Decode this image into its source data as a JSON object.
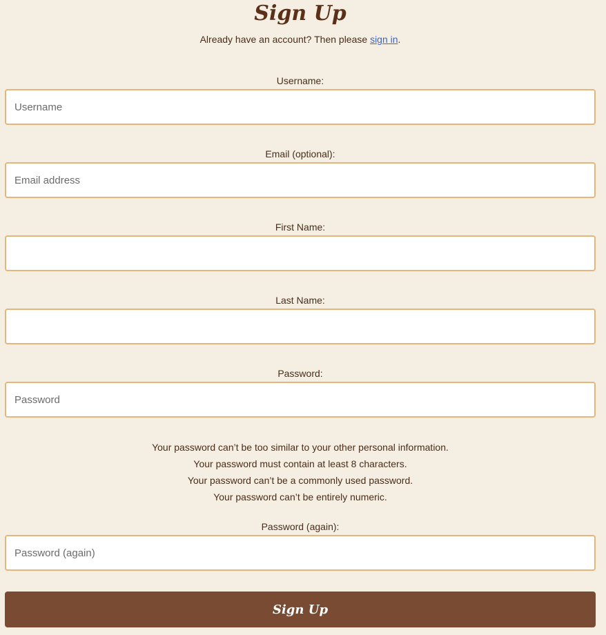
{
  "page": {
    "title": "Sign Up",
    "signin_prefix": "Already have an account? Then please ",
    "signin_link": "sign in",
    "signin_suffix": "."
  },
  "fields": {
    "username": {
      "label": "Username:",
      "placeholder": "Username",
      "value": ""
    },
    "email": {
      "label": "Email (optional):",
      "placeholder": "Email address",
      "value": ""
    },
    "first_name": {
      "label": "First Name:",
      "placeholder": "",
      "value": ""
    },
    "last_name": {
      "label": "Last Name:",
      "placeholder": "",
      "value": ""
    },
    "password": {
      "label": "Password:",
      "placeholder": "Password",
      "value": ""
    },
    "password_again": {
      "label": "Password (again):",
      "placeholder": "Password (again)",
      "value": ""
    }
  },
  "password_help": [
    "Your password can’t be too similar to your other personal information.",
    "Your password must contain at least 8 characters.",
    "Your password can’t be a commonly used password.",
    "Your password can’t be entirely numeric."
  ],
  "submit": {
    "label": "Sign Up"
  },
  "colors": {
    "background": "#f4efe2",
    "text": "#4a2c1a",
    "field_border": "#e6b57a",
    "link": "#3e64c9",
    "button": "#784b32"
  }
}
